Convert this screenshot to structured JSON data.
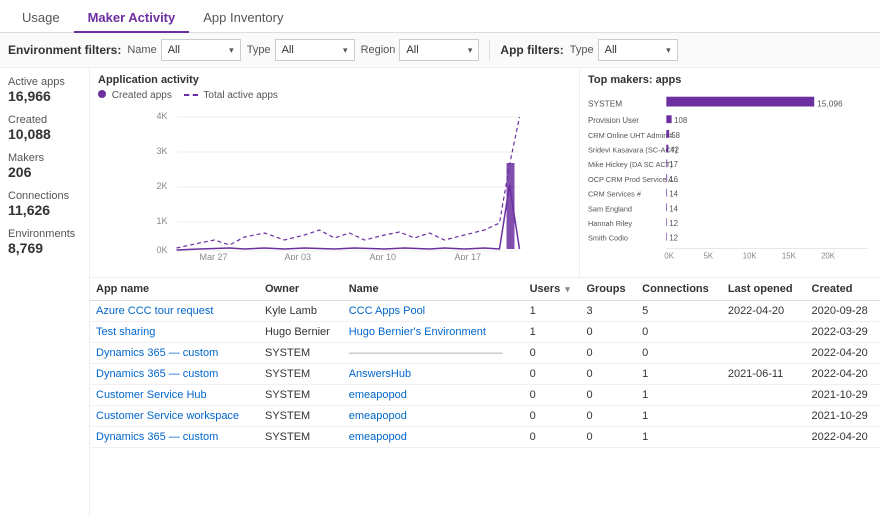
{
  "tabs": [
    {
      "id": "usage",
      "label": "Usage",
      "active": false
    },
    {
      "id": "maker-activity",
      "label": "Maker Activity",
      "active": true
    },
    {
      "id": "app-inventory",
      "label": "App Inventory",
      "active": false
    }
  ],
  "filters": {
    "environment_label": "Environment filters:",
    "app_label": "App filters:",
    "name": {
      "label": "Name",
      "value": "All"
    },
    "type_env": {
      "label": "Type",
      "value": "All"
    },
    "region": {
      "label": "Region",
      "value": "All"
    },
    "type_app": {
      "label": "Type",
      "value": "All"
    }
  },
  "stats": [
    {
      "label": "Active apps",
      "value": "16,966"
    },
    {
      "label": "Created",
      "value": "10,088"
    },
    {
      "label": "Makers",
      "value": "206"
    },
    {
      "label": "Connections",
      "value": "11,626"
    },
    {
      "label": "Environments",
      "value": "8,769"
    }
  ],
  "line_chart": {
    "title": "Application activity",
    "legend": [
      {
        "type": "dot",
        "label": "Created apps"
      },
      {
        "type": "dash",
        "label": "Total active apps"
      }
    ],
    "x_labels": [
      "Mar 27",
      "Apr 03",
      "Apr 10",
      "Apr 17"
    ],
    "y_labels": [
      "4K",
      "3K",
      "2K",
      "1K",
      "0K"
    ]
  },
  "bar_chart": {
    "title": "Top makers: apps",
    "bars": [
      {
        "name": "SYSTEM",
        "value": 15096,
        "max": 20000
      },
      {
        "name": "Provision User",
        "value": 108,
        "max": 20000
      },
      {
        "name": "CRM Online UHT Admin #",
        "value": 58,
        "max": 20000
      },
      {
        "name": "Sridevi Kasavara (SC-ACT)",
        "value": 42,
        "max": 20000
      },
      {
        "name": "Mike Hickey (DA SC ACT)",
        "value": 17,
        "max": 20000
      },
      {
        "name": "OCP CRM Prod Service A...",
        "value": 16,
        "max": 20000
      },
      {
        "name": "CRM Services #",
        "value": 14,
        "max": 20000
      },
      {
        "name": "Sam England",
        "value": 14,
        "max": 20000
      },
      {
        "name": "Hannah Riley",
        "value": 12,
        "max": 20000
      },
      {
        "name": "Smith Codio",
        "value": 12,
        "max": 20000
      }
    ],
    "x_labels": [
      "0K",
      "5K",
      "10K",
      "15K",
      "20K"
    ]
  },
  "table": {
    "columns": [
      {
        "id": "app_name",
        "label": "App name"
      },
      {
        "id": "owner",
        "label": "Owner"
      },
      {
        "id": "name",
        "label": "Name"
      },
      {
        "id": "users",
        "label": "Users"
      },
      {
        "id": "groups",
        "label": "Groups"
      },
      {
        "id": "connections",
        "label": "Connections"
      },
      {
        "id": "last_opened",
        "label": "Last opened"
      },
      {
        "id": "created",
        "label": "Created"
      }
    ],
    "rows": [
      {
        "app_name": "Azure CCC tour request",
        "owner": "Kyle Lamb",
        "name": "CCC Apps Pool",
        "users": 1,
        "groups": 3,
        "connections": 5,
        "last_opened": "2022-04-20",
        "created": "2020-09-28"
      },
      {
        "app_name": "Test sharing",
        "owner": "Hugo Bernier",
        "name": "Hugo Bernier's Environment",
        "users": 1,
        "groups": 0,
        "connections": 0,
        "last_opened": "",
        "created": "2022-03-29"
      },
      {
        "app_name": "Dynamics 365 — custom",
        "owner": "SYSTEM",
        "name": "——————————————",
        "users": 0,
        "groups": 0,
        "connections": 0,
        "last_opened": "",
        "created": "2022-04-20"
      },
      {
        "app_name": "Dynamics 365 — custom",
        "owner": "SYSTEM",
        "name": "AnswersHub",
        "users": 0,
        "groups": 0,
        "connections": 1,
        "last_opened": "2021-06-11",
        "created": "2022-04-20"
      },
      {
        "app_name": "Customer Service Hub",
        "owner": "SYSTEM",
        "name": "emeapopod",
        "users": 0,
        "groups": 0,
        "connections": 1,
        "last_opened": "",
        "created": "2021-10-29"
      },
      {
        "app_name": "Customer Service workspace",
        "owner": "SYSTEM",
        "name": "emeapopod",
        "users": 0,
        "groups": 0,
        "connections": 1,
        "last_opened": "",
        "created": "2021-10-29"
      },
      {
        "app_name": "Dynamics 365 — custom",
        "owner": "SYSTEM",
        "name": "emeapopod",
        "users": 0,
        "groups": 0,
        "connections": 1,
        "last_opened": "",
        "created": "2022-04-20"
      }
    ]
  }
}
